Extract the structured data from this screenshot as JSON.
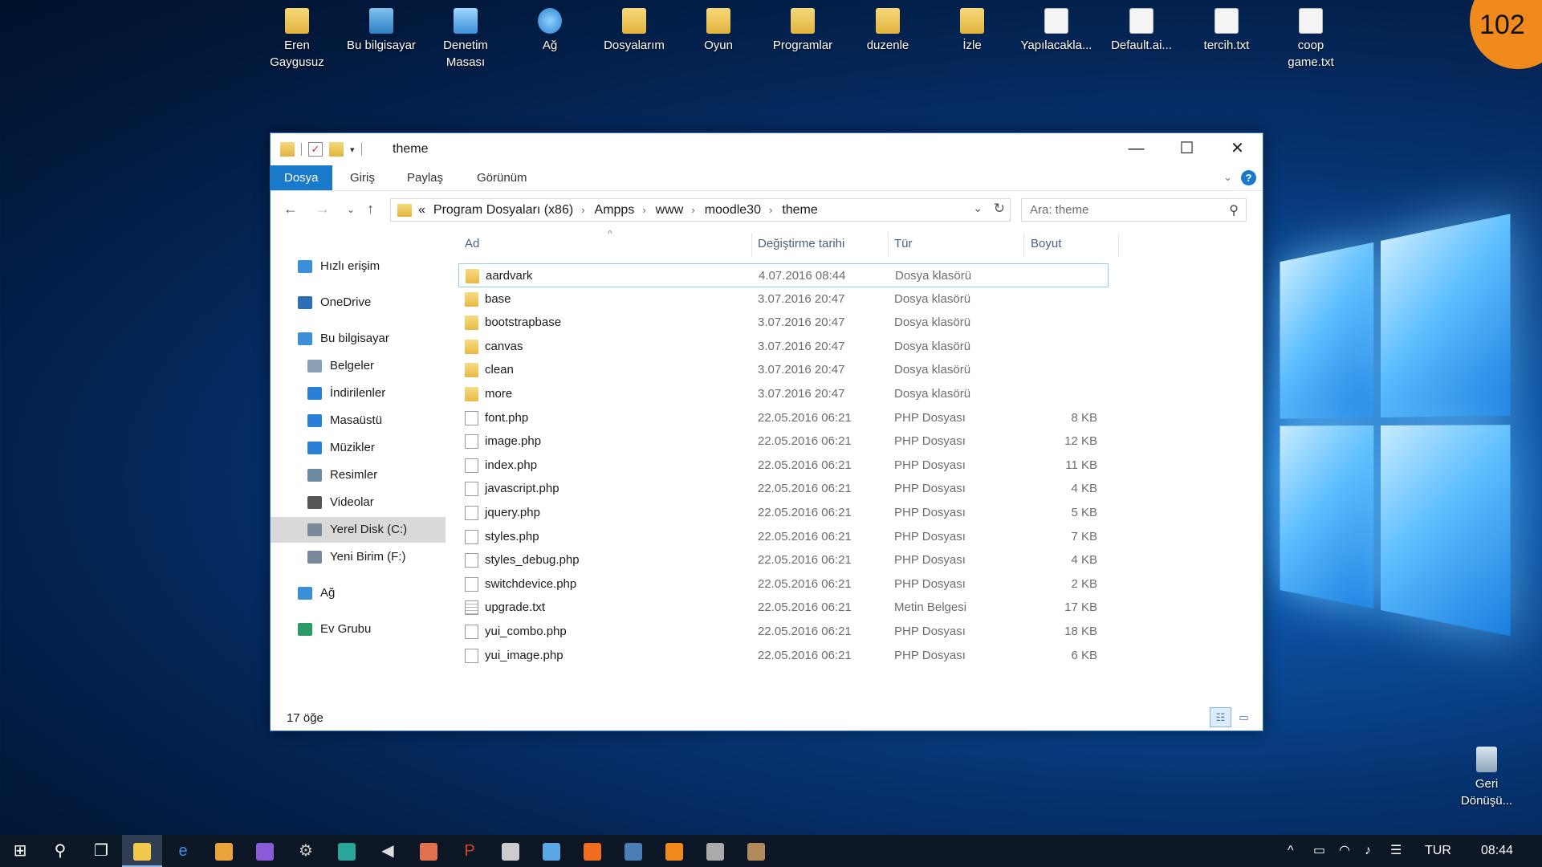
{
  "desktop": {
    "icons": [
      {
        "label": "Eren\nGaygusuz",
        "icon": "user-folder-icon"
      },
      {
        "label": "Bu bilgisayar",
        "icon": "computer-icon"
      },
      {
        "label": "Denetim\nMasası",
        "icon": "control-panel-icon"
      },
      {
        "label": "Ağ",
        "icon": "network-icon"
      },
      {
        "label": "Dosyalarım",
        "icon": "folder-icon"
      },
      {
        "label": "Oyun",
        "icon": "folder-icon"
      },
      {
        "label": "Programlar",
        "icon": "folder-icon"
      },
      {
        "label": "duzenle",
        "icon": "folder-icon"
      },
      {
        "label": "İzle",
        "icon": "folder-icon"
      },
      {
        "label": "Yapılacakla...",
        "icon": "text-file-icon"
      },
      {
        "label": "Default.ai...",
        "icon": "image-file-icon"
      },
      {
        "label": "tercih.txt",
        "icon": "text-file-icon"
      },
      {
        "label": "coop\ngame.txt",
        "icon": "text-file-icon"
      }
    ],
    "recycle_bin": "Geri\nDönüşü...",
    "badge": "102"
  },
  "window": {
    "title": "theme",
    "minimize": "—",
    "maximize": "☐",
    "close": "✕"
  },
  "ribbon": {
    "tabs": [
      "Dosya",
      "Giriş",
      "Paylaş",
      "Görünüm"
    ],
    "active_tab": "Dosya"
  },
  "address": {
    "overflow": "«",
    "crumbs": [
      "Program Dosyaları (x86)",
      "Ampps",
      "www",
      "moodle30",
      "theme"
    ]
  },
  "search": {
    "placeholder": "Ara: theme"
  },
  "sidebar": [
    {
      "label": "Hızlı erişim",
      "icon": "star-icon",
      "color": "#3a8fd8"
    },
    {
      "label": "OneDrive",
      "icon": "cloud-icon",
      "color": "#2a6fb8"
    },
    {
      "label": "Bu bilgisayar",
      "icon": "computer-icon",
      "color": "#3a8fd8"
    },
    {
      "label": "Belgeler",
      "icon": "documents-icon",
      "color": "#8a9fb4"
    },
    {
      "label": "İndirilenler",
      "icon": "download-icon",
      "color": "#2a7fd6"
    },
    {
      "label": "Masaüstü",
      "icon": "desktop-icon",
      "color": "#2a7fd6"
    },
    {
      "label": "Müzikler",
      "icon": "music-icon",
      "color": "#2a7fd6"
    },
    {
      "label": "Resimler",
      "icon": "pictures-icon",
      "color": "#6d8aa5"
    },
    {
      "label": "Videolar",
      "icon": "videos-icon",
      "color": "#555555"
    },
    {
      "label": "Yerel Disk (C:)",
      "icon": "drive-icon",
      "color": "#7a8a9a"
    },
    {
      "label": "Yeni Birim (F:)",
      "icon": "drive-icon",
      "color": "#7a8a9a"
    },
    {
      "label": "Ağ",
      "icon": "network-icon",
      "color": "#3a8fd8"
    },
    {
      "label": "Ev Grubu",
      "icon": "homegroup-icon",
      "color": "#2a9a6a"
    }
  ],
  "selected_sidebar": "Yerel Disk (C:)",
  "columns": {
    "name": "Ad",
    "date": "Değiştirme tarihi",
    "type": "Tür",
    "size": "Boyut"
  },
  "files": [
    {
      "name": "aardvark",
      "date": "4.07.2016 08:44",
      "type": "Dosya klasörü",
      "size": "",
      "kind": "folder"
    },
    {
      "name": "base",
      "date": "3.07.2016 20:47",
      "type": "Dosya klasörü",
      "size": "",
      "kind": "folder"
    },
    {
      "name": "bootstrapbase",
      "date": "3.07.2016 20:47",
      "type": "Dosya klasörü",
      "size": "",
      "kind": "folder"
    },
    {
      "name": "canvas",
      "date": "3.07.2016 20:47",
      "type": "Dosya klasörü",
      "size": "",
      "kind": "folder"
    },
    {
      "name": "clean",
      "date": "3.07.2016 20:47",
      "type": "Dosya klasörü",
      "size": "",
      "kind": "folder"
    },
    {
      "name": "more",
      "date": "3.07.2016 20:47",
      "type": "Dosya klasörü",
      "size": "",
      "kind": "folder"
    },
    {
      "name": "font.php",
      "date": "22.05.2016 06:21",
      "type": "PHP Dosyası",
      "size": "8 KB",
      "kind": "file"
    },
    {
      "name": "image.php",
      "date": "22.05.2016 06:21",
      "type": "PHP Dosyası",
      "size": "12 KB",
      "kind": "file"
    },
    {
      "name": "index.php",
      "date": "22.05.2016 06:21",
      "type": "PHP Dosyası",
      "size": "11 KB",
      "kind": "file"
    },
    {
      "name": "javascript.php",
      "date": "22.05.2016 06:21",
      "type": "PHP Dosyası",
      "size": "4 KB",
      "kind": "file"
    },
    {
      "name": "jquery.php",
      "date": "22.05.2016 06:21",
      "type": "PHP Dosyası",
      "size": "5 KB",
      "kind": "file"
    },
    {
      "name": "styles.php",
      "date": "22.05.2016 06:21",
      "type": "PHP Dosyası",
      "size": "7 KB",
      "kind": "file"
    },
    {
      "name": "styles_debug.php",
      "date": "22.05.2016 06:21",
      "type": "PHP Dosyası",
      "size": "4 KB",
      "kind": "file"
    },
    {
      "name": "switchdevice.php",
      "date": "22.05.2016 06:21",
      "type": "PHP Dosyası",
      "size": "2 KB",
      "kind": "file"
    },
    {
      "name": "upgrade.txt",
      "date": "22.05.2016 06:21",
      "type": "Metin Belgesi",
      "size": "17 KB",
      "kind": "txt"
    },
    {
      "name": "yui_combo.php",
      "date": "22.05.2016 06:21",
      "type": "PHP Dosyası",
      "size": "18 KB",
      "kind": "file"
    },
    {
      "name": "yui_image.php",
      "date": "22.05.2016 06:21",
      "type": "PHP Dosyası",
      "size": "6 KB",
      "kind": "file"
    }
  ],
  "selected_file": "aardvark",
  "status": {
    "count": "17 öğe"
  },
  "taskbar": {
    "apps": [
      {
        "name": "start-button",
        "glyph": "⊞",
        "color": "#ffffff"
      },
      {
        "name": "search-button",
        "glyph": "⚲",
        "color": "#ffffff"
      },
      {
        "name": "task-view-button",
        "glyph": "❐",
        "color": "#ffffff"
      },
      {
        "name": "file-explorer-app",
        "glyph": "",
        "color": "#f2c94c"
      },
      {
        "name": "edge-app",
        "glyph": "e",
        "color": "#3b8fe0"
      },
      {
        "name": "chrome-app",
        "glyph": "",
        "color": "#e8a33a"
      },
      {
        "name": "visual-studio-app",
        "glyph": "",
        "color": "#8a5bd6"
      },
      {
        "name": "settings-app",
        "glyph": "⚙",
        "color": "#c8c8c8"
      },
      {
        "name": "sublime-app",
        "glyph": "",
        "color": "#2aa59a"
      },
      {
        "name": "media-app",
        "glyph": "◀",
        "color": "#dddddd"
      },
      {
        "name": "paint-app",
        "glyph": "",
        "color": "#e07050"
      },
      {
        "name": "powerpoint-app",
        "glyph": "P",
        "color": "#d24726"
      },
      {
        "name": "chrome-alt-app",
        "glyph": "",
        "color": "#cccccc"
      },
      {
        "name": "camera-app",
        "glyph": "",
        "color": "#5aa9e6"
      },
      {
        "name": "origin-app",
        "glyph": "",
        "color": "#f06c1f"
      },
      {
        "name": "steam-app",
        "glyph": "",
        "color": "#4a7fb5"
      },
      {
        "name": "vlc-app",
        "glyph": "",
        "color": "#f08a1c"
      },
      {
        "name": "box-app",
        "glyph": "",
        "color": "#aaaaaa"
      },
      {
        "name": "gimp-app",
        "glyph": "",
        "color": "#b08a5a"
      }
    ],
    "language": "TUR",
    "time": "08:44"
  }
}
